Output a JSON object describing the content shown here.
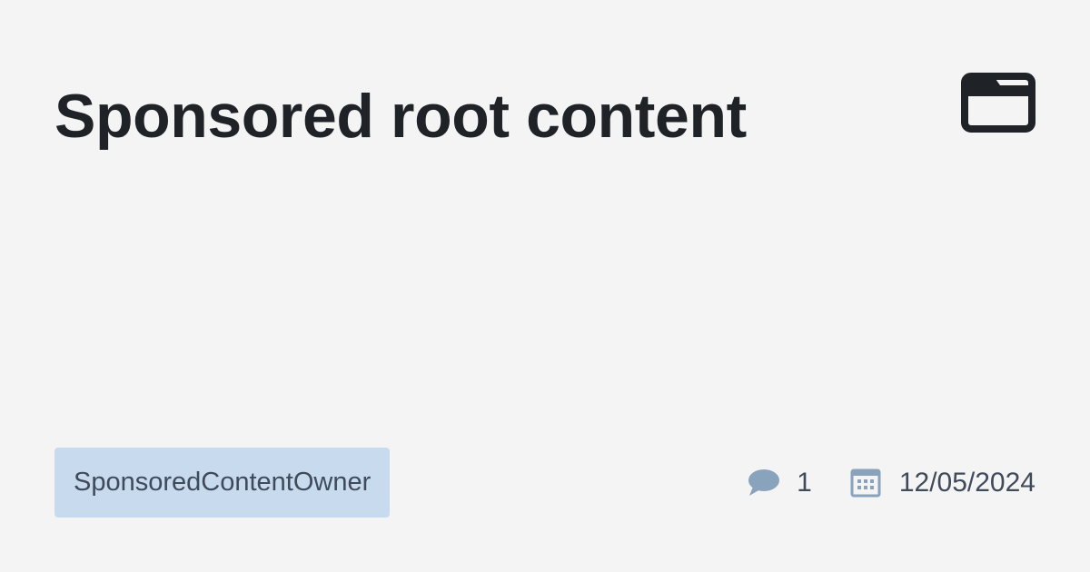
{
  "post": {
    "title": "Sponsored root content",
    "category_icon": "folder-icon",
    "tag": "SponsoredContentOwner",
    "comment_icon": "comment-bubble-icon",
    "comment_count": "1",
    "date_icon": "calendar-icon",
    "date": "12/05/2024"
  },
  "colors": {
    "background": "#f4f4f4",
    "title": "#1f2227",
    "tag_background": "#c8dbee",
    "meta_text": "#3f4a5a",
    "meta_icon": "#8aa3bd"
  }
}
